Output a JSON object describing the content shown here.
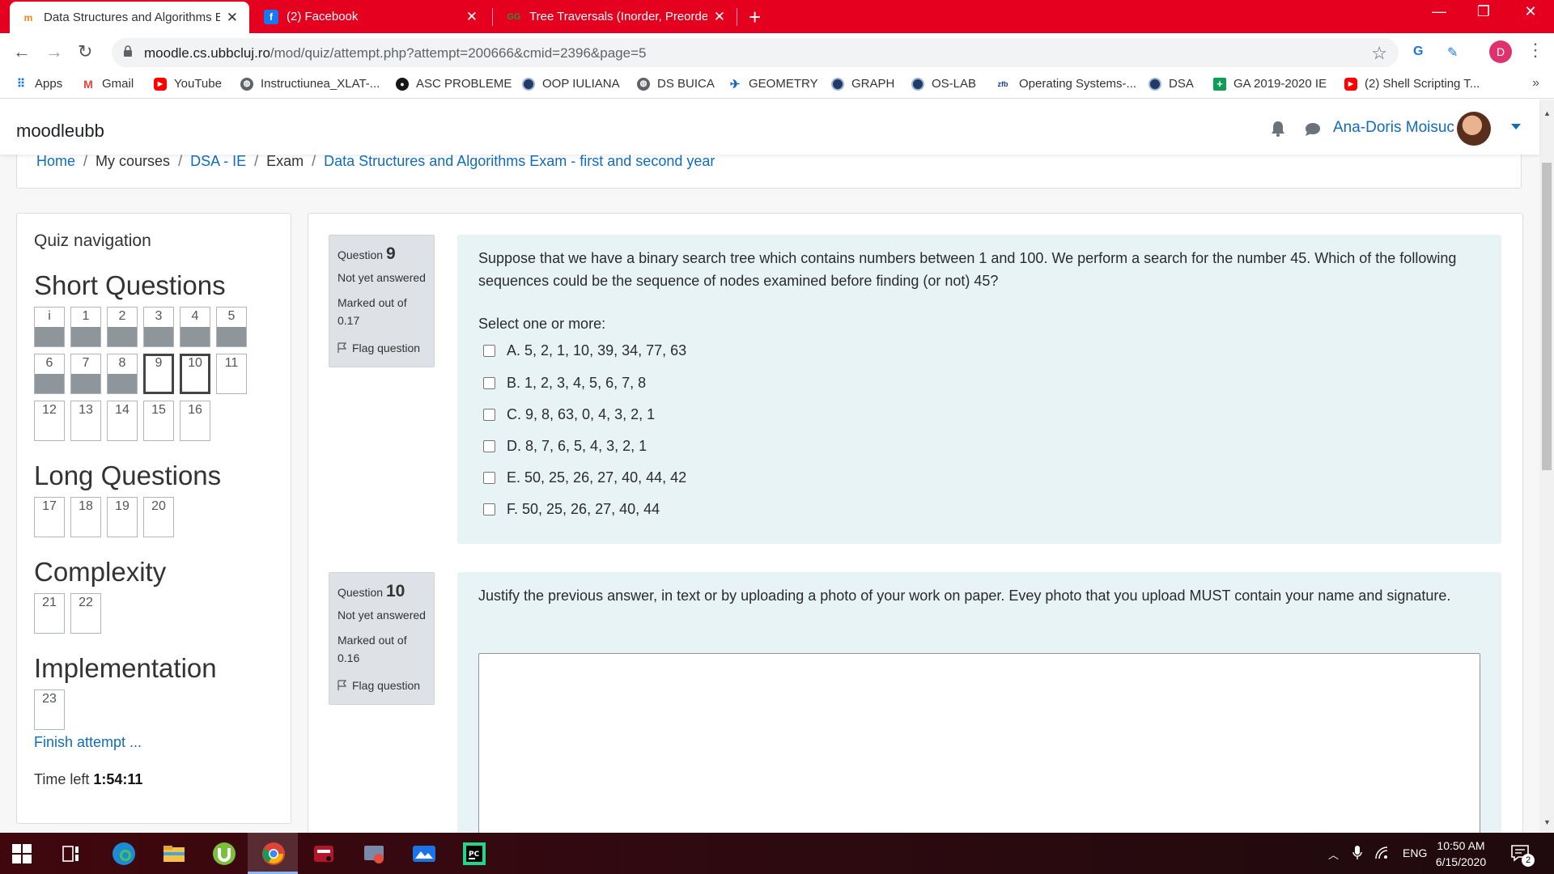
{
  "browser": {
    "tabs": [
      {
        "title": "Data Structures and Algorithms E",
        "icon": "moodle-icon",
        "active": true
      },
      {
        "title": "(2) Facebook",
        "icon": "facebook-icon",
        "active": false
      },
      {
        "title": "Tree Traversals (Inorder, Preorder",
        "icon": "gfg-icon",
        "active": false
      }
    ],
    "url_host": "moodle.cs.ubbcluj.ro",
    "url_path": "/mod/quiz/attempt.php?attempt=200666&cmid=2396&page=5",
    "profile_initial": "D",
    "bookmarks": [
      {
        "label": "Apps",
        "icon": "apps-grid-icon"
      },
      {
        "label": "Gmail",
        "icon": "gmail-icon"
      },
      {
        "label": "YouTube",
        "icon": "youtube-icon"
      },
      {
        "label": "Instructiunea_XLAT-...",
        "icon": "globe-icon"
      },
      {
        "label": "ASC PROBLEME",
        "icon": "github-icon"
      },
      {
        "label": "OOP IULIANA",
        "icon": "ubb-icon"
      },
      {
        "label": "DS BUICA",
        "icon": "globe-icon"
      },
      {
        "label": "GEOMETRY",
        "icon": "bird-icon"
      },
      {
        "label": "GRAPH",
        "icon": "ubb-icon"
      },
      {
        "label": "OS-LAB",
        "icon": "ubb-icon"
      },
      {
        "label": "Operating Systems-...",
        "icon": "zfb-icon"
      },
      {
        "label": "DSA",
        "icon": "ubb-icon"
      },
      {
        "label": "GA 2019-2020 IE",
        "icon": "sheets-icon"
      },
      {
        "label": "(2) Shell Scripting T...",
        "icon": "youtube-icon"
      }
    ],
    "more_bookmarks": "»"
  },
  "header": {
    "brand": "moodleubb",
    "user_name": "Ana-Doris Moisuc"
  },
  "breadcrumb": [
    "Home",
    "My courses",
    "DSA - IE",
    "Exam",
    "Data Structures and Algorithms Exam - first and second year"
  ],
  "quiz_nav": {
    "title": "Quiz navigation",
    "sections": [
      {
        "heading": "Short Questions"
      },
      {
        "heading": "Long Questions"
      },
      {
        "heading": "Complexity"
      },
      {
        "heading": "Implementation"
      }
    ],
    "buttons": [
      {
        "label": "i",
        "state": "answered"
      },
      {
        "label": "1",
        "state": "answered"
      },
      {
        "label": "2",
        "state": "answered"
      },
      {
        "label": "3",
        "state": "answered"
      },
      {
        "label": "4",
        "state": "answered"
      },
      {
        "label": "5",
        "state": "answered"
      },
      {
        "label": "6",
        "state": "answered"
      },
      {
        "label": "7",
        "state": "answered"
      },
      {
        "label": "8",
        "state": "answered"
      },
      {
        "label": "9",
        "state": "current"
      },
      {
        "label": "10",
        "state": "current"
      },
      {
        "label": "11",
        "state": "unanswered"
      },
      {
        "label": "12",
        "state": "unanswered"
      },
      {
        "label": "13",
        "state": "unanswered"
      },
      {
        "label": "14",
        "state": "unanswered"
      },
      {
        "label": "15",
        "state": "unanswered"
      },
      {
        "label": "16",
        "state": "unanswered"
      },
      {
        "label": "17",
        "state": "unanswered"
      },
      {
        "label": "18",
        "state": "unanswered"
      },
      {
        "label": "19",
        "state": "unanswered"
      },
      {
        "label": "20",
        "state": "unanswered"
      },
      {
        "label": "21",
        "state": "unanswered"
      },
      {
        "label": "22",
        "state": "unanswered"
      },
      {
        "label": "23",
        "state": "unanswered"
      }
    ],
    "finish": "Finish attempt ...",
    "time_left_label": "Time left",
    "time_left": "1:54:11"
  },
  "questions": [
    {
      "prefix": "Question",
      "number": "9",
      "state": "Not yet answered",
      "grade": "Marked out of 0.17",
      "flag": "Flag question",
      "text": "Suppose that we have a binary search tree which contains numbers between 1 and 100. We perform a search for the number 45. Which of the following sequences could be the sequence of nodes examined before finding (or not) 45?",
      "prompt": "Select one or more:",
      "options": [
        "A. 5, 2, 1, 10, 39, 34, 77, 63",
        "B. 1, 2, 3, 4, 5, 6, 7, 8",
        "C. 9, 8, 63, 0, 4, 3, 2, 1",
        "D. 8, 7, 6, 5, 4, 3, 2, 1",
        "E. 50, 25, 26, 27, 40, 44, 42",
        "F. 50, 25, 26, 27, 40, 44"
      ]
    },
    {
      "prefix": "Question",
      "number": "10",
      "state": "Not yet answered",
      "grade": "Marked out of 0.16",
      "flag": "Flag question",
      "text": "Justify the previous answer, in text or by uploading a photo of your work on paper. Evey photo that you upload MUST contain your name and signature."
    }
  ],
  "taskbar": {
    "language": "ENG",
    "time": "10:50 AM",
    "date": "6/15/2020",
    "notifications": "2"
  },
  "colors": {
    "tabstrip": "#e4001e",
    "link": "#0f6cbf",
    "question_bg": "#e7f3f5",
    "info_bg": "#dee2e6"
  }
}
